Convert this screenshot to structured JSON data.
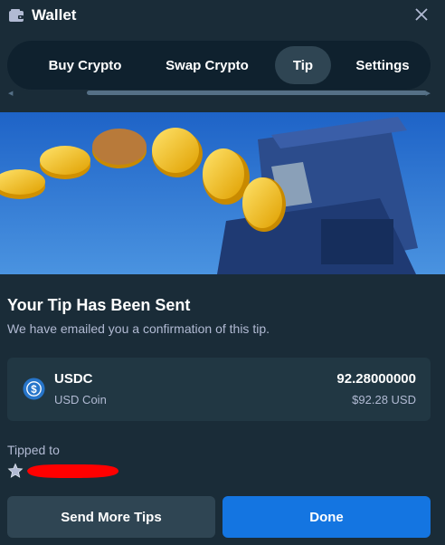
{
  "header": {
    "title": "Wallet",
    "wallet_icon": "wallet-icon",
    "close_icon": "close-icon"
  },
  "tabs": [
    {
      "label": "Buy Crypto",
      "active": false
    },
    {
      "label": "Swap Crypto",
      "active": false
    },
    {
      "label": "Tip",
      "active": true
    },
    {
      "label": "Settings",
      "active": false
    }
  ],
  "confirmation": {
    "title": "Your Tip Has Been Sent",
    "subtitle": "We have emailed you a confirmation of this tip."
  },
  "coin": {
    "icon": "usdc-icon",
    "symbol": "USDC",
    "name": "USD Coin",
    "amount": "92.28000000",
    "usd_value": "$92.28 USD"
  },
  "tipped": {
    "label": "Tipped to",
    "icon": "star-icon"
  },
  "buttons": {
    "send_more": "Send More Tips",
    "done": "Done"
  },
  "colors": {
    "background": "#1a2c38",
    "card": "#213743",
    "tab_bar": "#0f212e",
    "active_tab": "#2f4553",
    "primary": "#1475e1",
    "muted_text": "#b1bad3",
    "usdc_blue": "#2775ca",
    "redaction": "#ff0000"
  }
}
